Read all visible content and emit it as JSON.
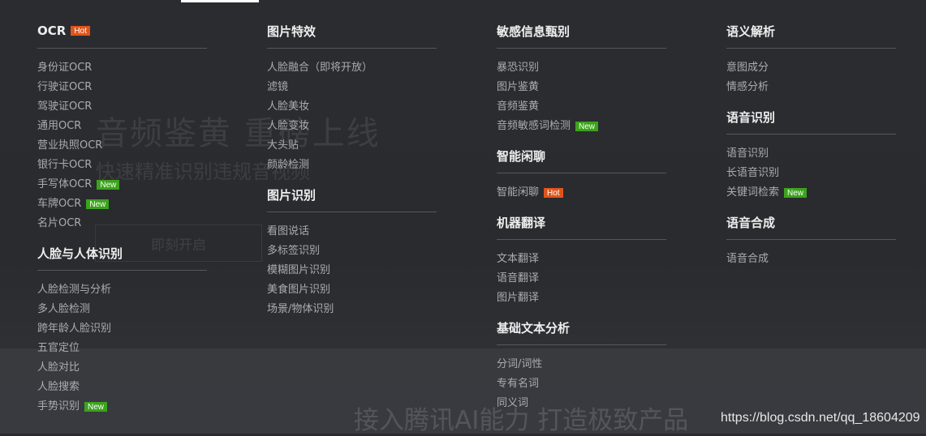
{
  "banner": {
    "title": "音频鉴黄 重磅上线",
    "subtitle": "快速精准识别违规音视频",
    "cta_label": "即刻开启",
    "slogan": "接入腾讯AI能力 打造极致产品"
  },
  "watermark": "https://blog.csdn.net/qq_18604209",
  "colors": {
    "hot_badge": "#e0541b",
    "new_badge": "#3ba31c",
    "background": "#2a2b2e"
  },
  "menu": {
    "col1": {
      "ocr": {
        "title": "OCR",
        "badge": "Hot",
        "items": [
          {
            "label": "身份证OCR"
          },
          {
            "label": "行驶证OCR"
          },
          {
            "label": "驾驶证OCR"
          },
          {
            "label": "通用OCR"
          },
          {
            "label": "营业执照OCR"
          },
          {
            "label": "银行卡OCR"
          },
          {
            "label": "手写体OCR",
            "badge": "New"
          },
          {
            "label": "车牌OCR",
            "badge": "New"
          },
          {
            "label": "名片OCR"
          }
        ]
      },
      "face": {
        "title": "人脸与人体识别",
        "items": [
          {
            "label": "人脸检测与分析"
          },
          {
            "label": "多人脸检测"
          },
          {
            "label": "跨年龄人脸识别"
          },
          {
            "label": "五官定位"
          },
          {
            "label": "人脸对比"
          },
          {
            "label": "人脸搜索"
          },
          {
            "label": "手势识别",
            "badge": "New"
          }
        ]
      }
    },
    "col2": {
      "effects": {
        "title": "图片特效",
        "items": [
          {
            "label": "人脸融合（即将开放）"
          },
          {
            "label": "滤镜"
          },
          {
            "label": "人脸美妆"
          },
          {
            "label": "人脸变妆"
          },
          {
            "label": "大头贴"
          },
          {
            "label": "颜龄检测"
          }
        ]
      },
      "image_recog": {
        "title": "图片识别",
        "items": [
          {
            "label": "看图说话"
          },
          {
            "label": "多标签识别"
          },
          {
            "label": "模糊图片识别"
          },
          {
            "label": "美食图片识别"
          },
          {
            "label": "场景/物体识别"
          }
        ]
      }
    },
    "col3": {
      "sensitive": {
        "title": "敏感信息甄别",
        "items": [
          {
            "label": "暴恐识别"
          },
          {
            "label": "图片鉴黄"
          },
          {
            "label": "音频鉴黄"
          },
          {
            "label": "音频敏感词检测",
            "badge": "New"
          }
        ]
      },
      "chat": {
        "title": "智能闲聊",
        "items": [
          {
            "label": "智能闲聊",
            "badge": "Hot"
          }
        ]
      },
      "translate": {
        "title": "机器翻译",
        "items": [
          {
            "label": "文本翻译"
          },
          {
            "label": "语音翻译"
          },
          {
            "label": "图片翻译"
          }
        ]
      },
      "text_analysis": {
        "title": "基础文本分析",
        "items": [
          {
            "label": "分词/词性"
          },
          {
            "label": "专有名词"
          },
          {
            "label": "同义词"
          }
        ]
      }
    },
    "col4": {
      "semantic": {
        "title": "语义解析",
        "items": [
          {
            "label": "意图成分"
          },
          {
            "label": "情感分析"
          }
        ]
      },
      "asr": {
        "title": "语音识别",
        "items": [
          {
            "label": "语音识别"
          },
          {
            "label": "长语音识别"
          },
          {
            "label": "关键词检索",
            "badge": "New"
          }
        ]
      },
      "tts": {
        "title": "语音合成",
        "items": [
          {
            "label": "语音合成"
          }
        ]
      }
    }
  }
}
